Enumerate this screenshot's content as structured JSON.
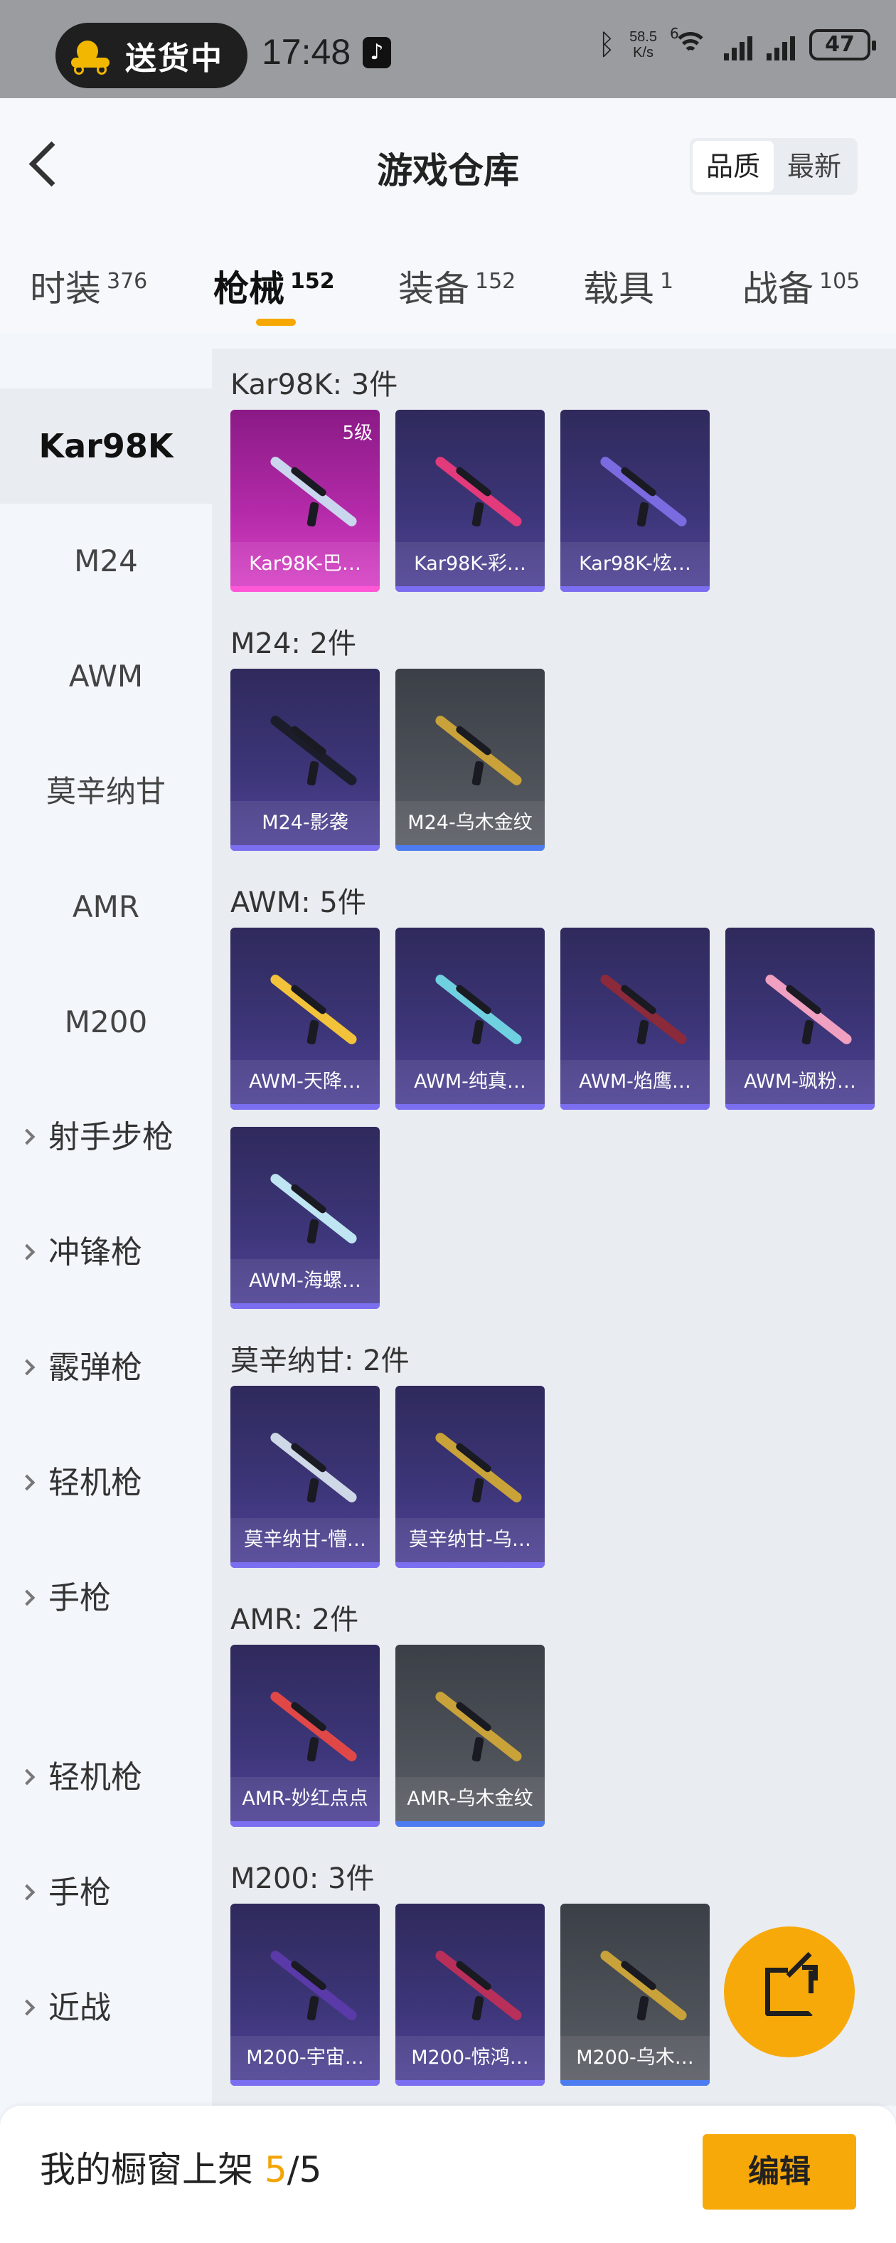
{
  "status_bar": {
    "pill_label": "送货中",
    "time": "17:48",
    "net_speed_value": "58.5",
    "net_speed_unit": "K/s",
    "wifi_badge": "6",
    "battery": "47"
  },
  "header": {
    "title": "游戏仓库",
    "sort_options": [
      "品质",
      "最新"
    ],
    "sort_selected": "品质"
  },
  "tabs": [
    {
      "label": "时装",
      "count": "376"
    },
    {
      "label": "枪械",
      "count": "152",
      "active": true
    },
    {
      "label": "装备",
      "count": "152"
    },
    {
      "label": "载具",
      "count": "1"
    },
    {
      "label": "战备",
      "count": "105"
    }
  ],
  "sidenav": {
    "items": [
      "Kar98K",
      "M24",
      "AWM",
      "莫辛纳甘",
      "AMR",
      "M200"
    ],
    "groups": [
      "射手步枪",
      "冲锋枪",
      "霰弹枪",
      "轻机枪",
      "手枪",
      "轻机枪",
      "手枪",
      "近战"
    ],
    "active": "Kar98K"
  },
  "sections": [
    {
      "title": "Kar98K: 3件",
      "items": [
        {
          "label": "Kar98K-巴…",
          "rarity": "pink",
          "level": "5级",
          "gun_color": "#c9d6ee"
        },
        {
          "label": "Kar98K-彩…",
          "rarity": "purple",
          "gun_color": "#e23a7a"
        },
        {
          "label": "Kar98K-炫…",
          "rarity": "purple",
          "gun_color": "#7a6be0"
        }
      ]
    },
    {
      "title": "M24: 2件",
      "items": [
        {
          "label": "M24-影袭",
          "rarity": "purple",
          "gun_color": "#1b1d2b"
        },
        {
          "label": "M24-乌木金纹",
          "rarity": "gold",
          "gun_color": "#c9a23a"
        }
      ]
    },
    {
      "title": "AWM: 5件",
      "items": [
        {
          "label": "AWM-天降…",
          "rarity": "purple",
          "gun_color": "#f2c23a"
        },
        {
          "label": "AWM-纯真…",
          "rarity": "purple",
          "gun_color": "#6fd0e0"
        },
        {
          "label": "AWM-焰鹰…",
          "rarity": "purple",
          "gun_color": "#8a2a3a"
        },
        {
          "label": "AWM-飒粉…",
          "rarity": "purple",
          "gun_color": "#f0a0c0"
        },
        {
          "label": "AWM-海螺…",
          "rarity": "purple",
          "gun_color": "#bfe4f2"
        }
      ]
    },
    {
      "title": "莫辛纳甘: 2件",
      "items": [
        {
          "label": "莫辛纳甘-懵…",
          "rarity": "purple",
          "gun_color": "#cfd8e6"
        },
        {
          "label": "莫辛纳甘-乌…",
          "rarity": "purple",
          "gun_color": "#c9a23a"
        }
      ]
    },
    {
      "title": "AMR: 2件",
      "items": [
        {
          "label": "AMR-妙红点点",
          "rarity": "purple",
          "gun_color": "#e04848"
        },
        {
          "label": "AMR-乌木金纹",
          "rarity": "gold",
          "gun_color": "#c9a23a"
        }
      ]
    },
    {
      "title": "M200: 3件",
      "items": [
        {
          "label": "M200-宇宙…",
          "rarity": "purple",
          "gun_color": "#5a3aa8"
        },
        {
          "label": "M200-惊鸿…",
          "rarity": "purple",
          "gun_color": "#b8305a"
        },
        {
          "label": "M200-乌木…",
          "rarity": "gold",
          "gun_color": "#c9a23a"
        }
      ]
    }
  ],
  "footer": {
    "label": "我的橱窗上架",
    "shown": "5",
    "total": "/5",
    "edit_button": "编辑"
  },
  "colors": {
    "accent": "#f7a90a",
    "pink_rarity": "#d944c7",
    "purple_rarity": "#514497",
    "gold_rarity": "#5b5f66"
  }
}
